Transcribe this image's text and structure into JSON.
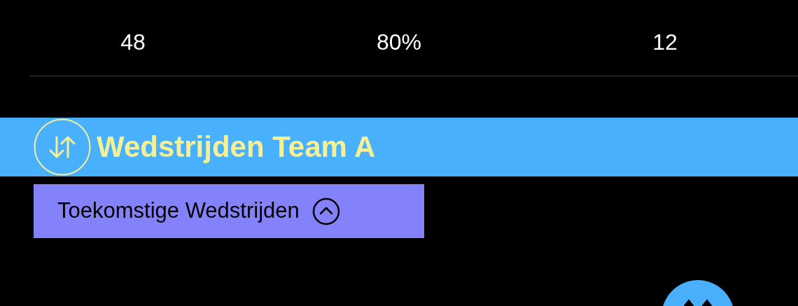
{
  "stats": [
    {
      "value": "48"
    },
    {
      "value": "80%"
    },
    {
      "value": "12"
    }
  ],
  "section": {
    "title": "Wedstrijden Team A"
  },
  "toggle": {
    "label": "Toekomstige Wedstrijden",
    "expanded": true
  }
}
